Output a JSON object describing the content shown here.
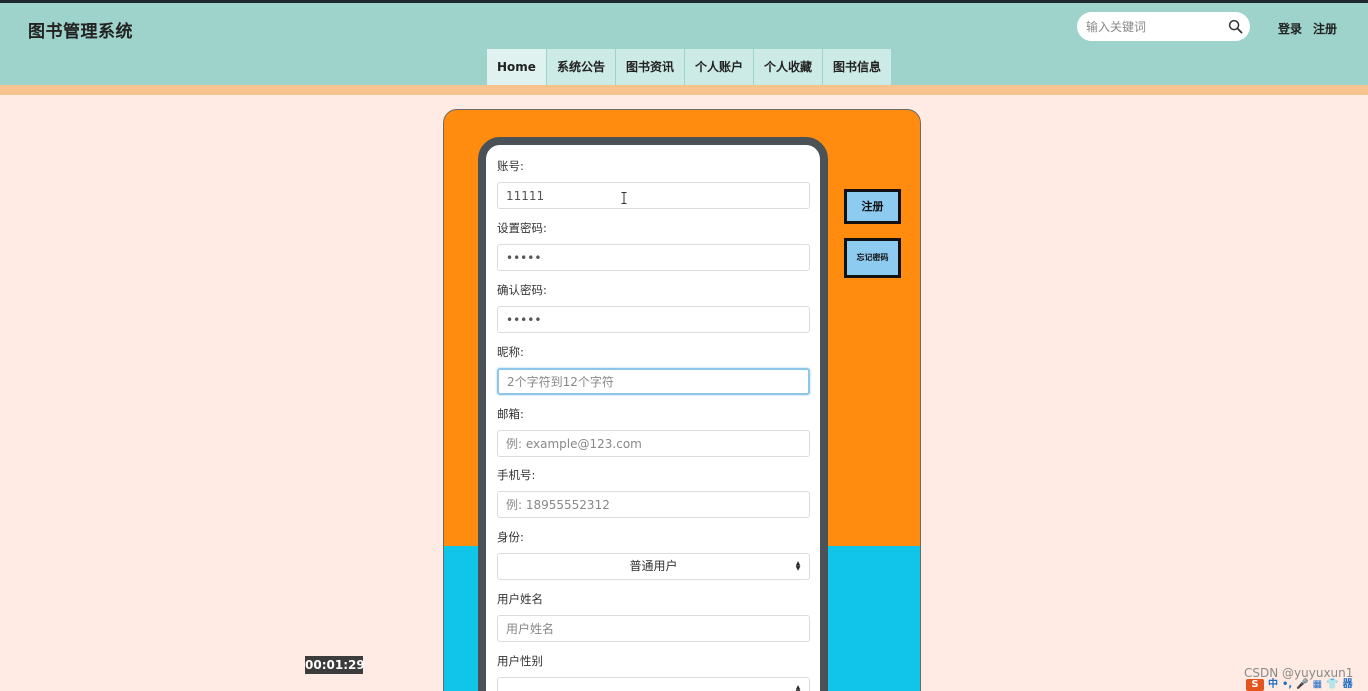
{
  "header": {
    "brand": "图书管理系统",
    "search_placeholder": "输入关键词",
    "login": "登录",
    "register": "注册"
  },
  "nav": {
    "items": [
      {
        "label": "Home"
      },
      {
        "label": "系统公告"
      },
      {
        "label": "图书资讯"
      },
      {
        "label": "个人账户"
      },
      {
        "label": "个人收藏"
      },
      {
        "label": "图书信息"
      }
    ]
  },
  "form": {
    "account": {
      "label": "账号:",
      "value": "11111"
    },
    "password": {
      "label": "设置密码:",
      "value": "•••••"
    },
    "confirm": {
      "label": "确认密码:",
      "value": "•••••"
    },
    "nickname": {
      "label": "昵称:",
      "placeholder": "2个字符到12个字符"
    },
    "email": {
      "label": "邮箱:",
      "placeholder": "例: example@123.com"
    },
    "phone": {
      "label": "手机号:",
      "placeholder": "例: 18955552312"
    },
    "identity": {
      "label": "身份:",
      "selected": "普通用户"
    },
    "realname": {
      "label": "用户姓名",
      "placeholder": "用户姓名"
    },
    "gender": {
      "label": "用户性别",
      "selected": ""
    }
  },
  "side_buttons": {
    "register": "注册",
    "forgot": "忘记密码"
  },
  "overlay": {
    "timestamp": "00:01:29",
    "watermark": "CSDN @yuyuxun1"
  },
  "tray": {
    "items": [
      "S",
      "中",
      "•,",
      "🎤",
      "▦",
      "👕",
      "器"
    ]
  },
  "colors": {
    "header_bg": "#9dd3cb",
    "stripe": "#f7c38c",
    "page_bg": "#ffebe3",
    "panel_top": "#ff8c0e",
    "panel_bottom": "#10c4ea",
    "side_button": "#8ecbf0"
  }
}
